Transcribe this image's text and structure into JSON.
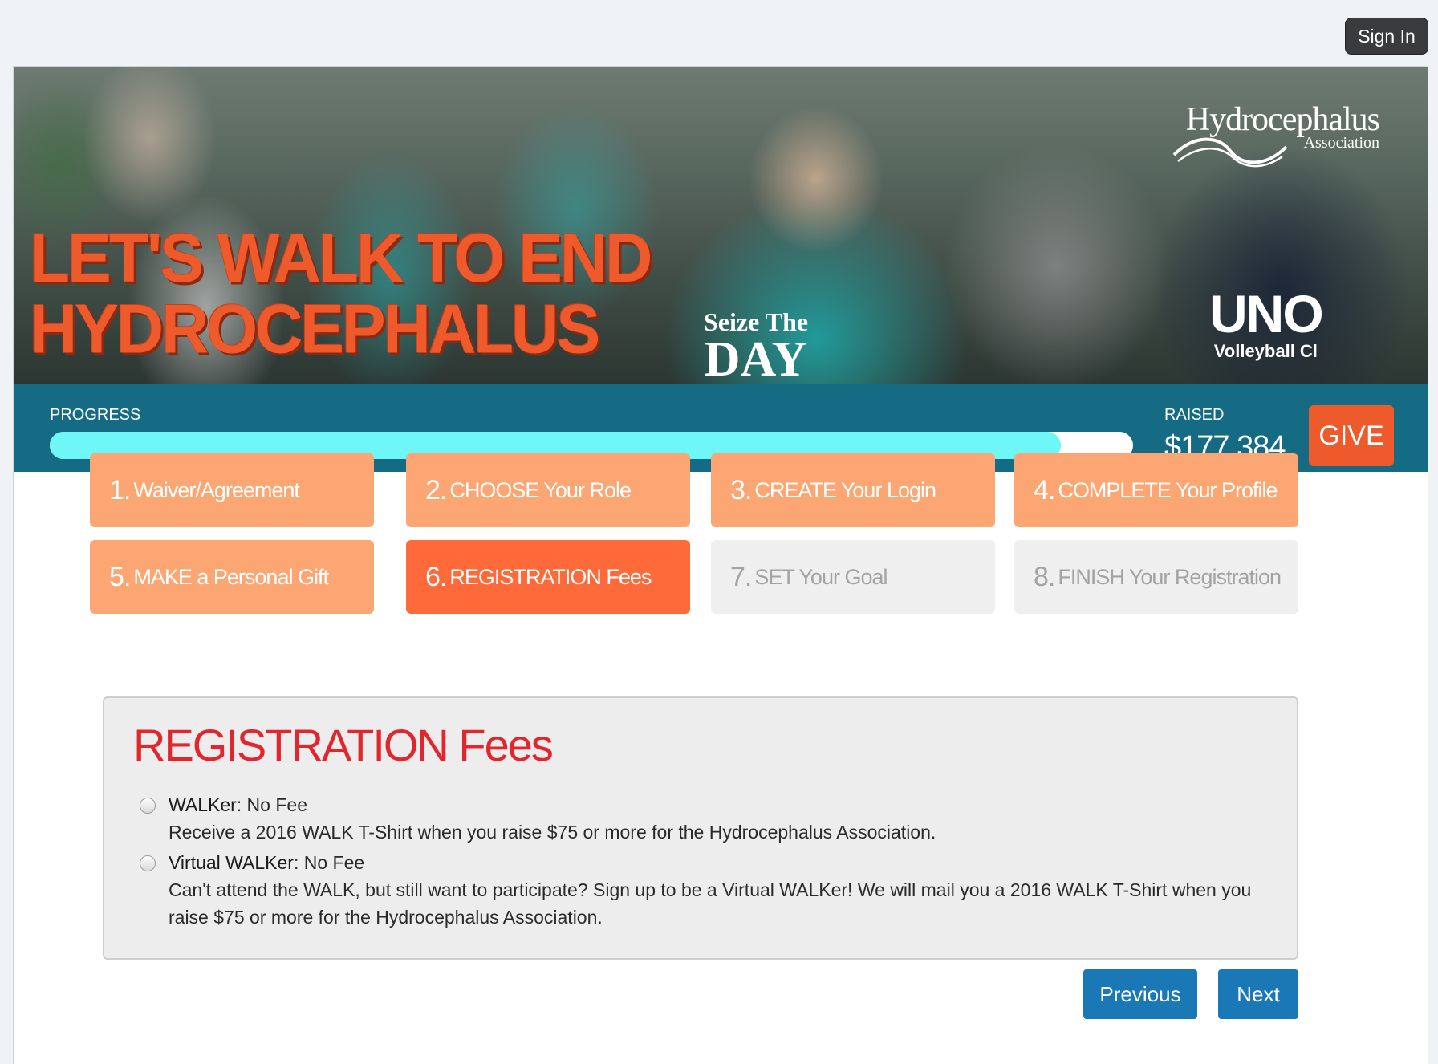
{
  "header": {
    "signin_label": "Sign In"
  },
  "hero": {
    "headline_line1": "LET'S WALK TO END",
    "headline_line2": "HYDROCEPHALUS",
    "logo_line1": "Hydrocephalus",
    "logo_line2": "Association",
    "shirt_line1": "Seize The",
    "shirt_line2": "DAY",
    "uno_line1": "UNO",
    "uno_line2": "Volleyball Cl"
  },
  "progress": {
    "label": "PROGRESS",
    "fraction": 0.933,
    "raised_label": "RAISED",
    "raised_value": "$177,384",
    "give_label": "GIVE"
  },
  "steps": [
    {
      "num": "1.",
      "label": "Waiver/Agreement",
      "state": "done"
    },
    {
      "num": "2.",
      "label": "CHOOSE Your Role",
      "state": "done"
    },
    {
      "num": "3.",
      "label": "CREATE Your Login",
      "state": "done"
    },
    {
      "num": "4.",
      "label": "COMPLETE Your Profile",
      "state": "done"
    },
    {
      "num": "5.",
      "label": "MAKE a Personal Gift",
      "state": "done"
    },
    {
      "num": "6.",
      "label": "REGISTRATION Fees",
      "state": "active"
    },
    {
      "num": "7.",
      "label": "SET Your Goal",
      "state": "todo"
    },
    {
      "num": "8.",
      "label": "FINISH Your Registration",
      "state": "todo"
    }
  ],
  "panel": {
    "title": "REGISTRATION Fees",
    "options": [
      {
        "name": "WALKer",
        "fee": ": No Fee",
        "description": "Receive a 2016 WALK T-Shirt when you raise $75 or more for the Hydrocephalus Association."
      },
      {
        "name": "Virtual WALKer",
        "fee": ": No Fee",
        "description": "Can't attend the WALK, but still want to participate? Sign up to be a Virtual WALKer! We will mail you a 2016 WALK T-Shirt when you raise $75 or more for the Hydrocephalus Association."
      }
    ]
  },
  "nav": {
    "previous_label": "Previous",
    "next_label": "Next"
  },
  "colors": {
    "progress_band": "#156b84",
    "progress_fill": "#6ff6f6",
    "give": "#ee5a2c",
    "step_done": "#fca673",
    "step_active": "#ff6a3a",
    "step_todo": "#efefef",
    "title_red": "#e3252e",
    "button_blue": "#1b78b7"
  }
}
